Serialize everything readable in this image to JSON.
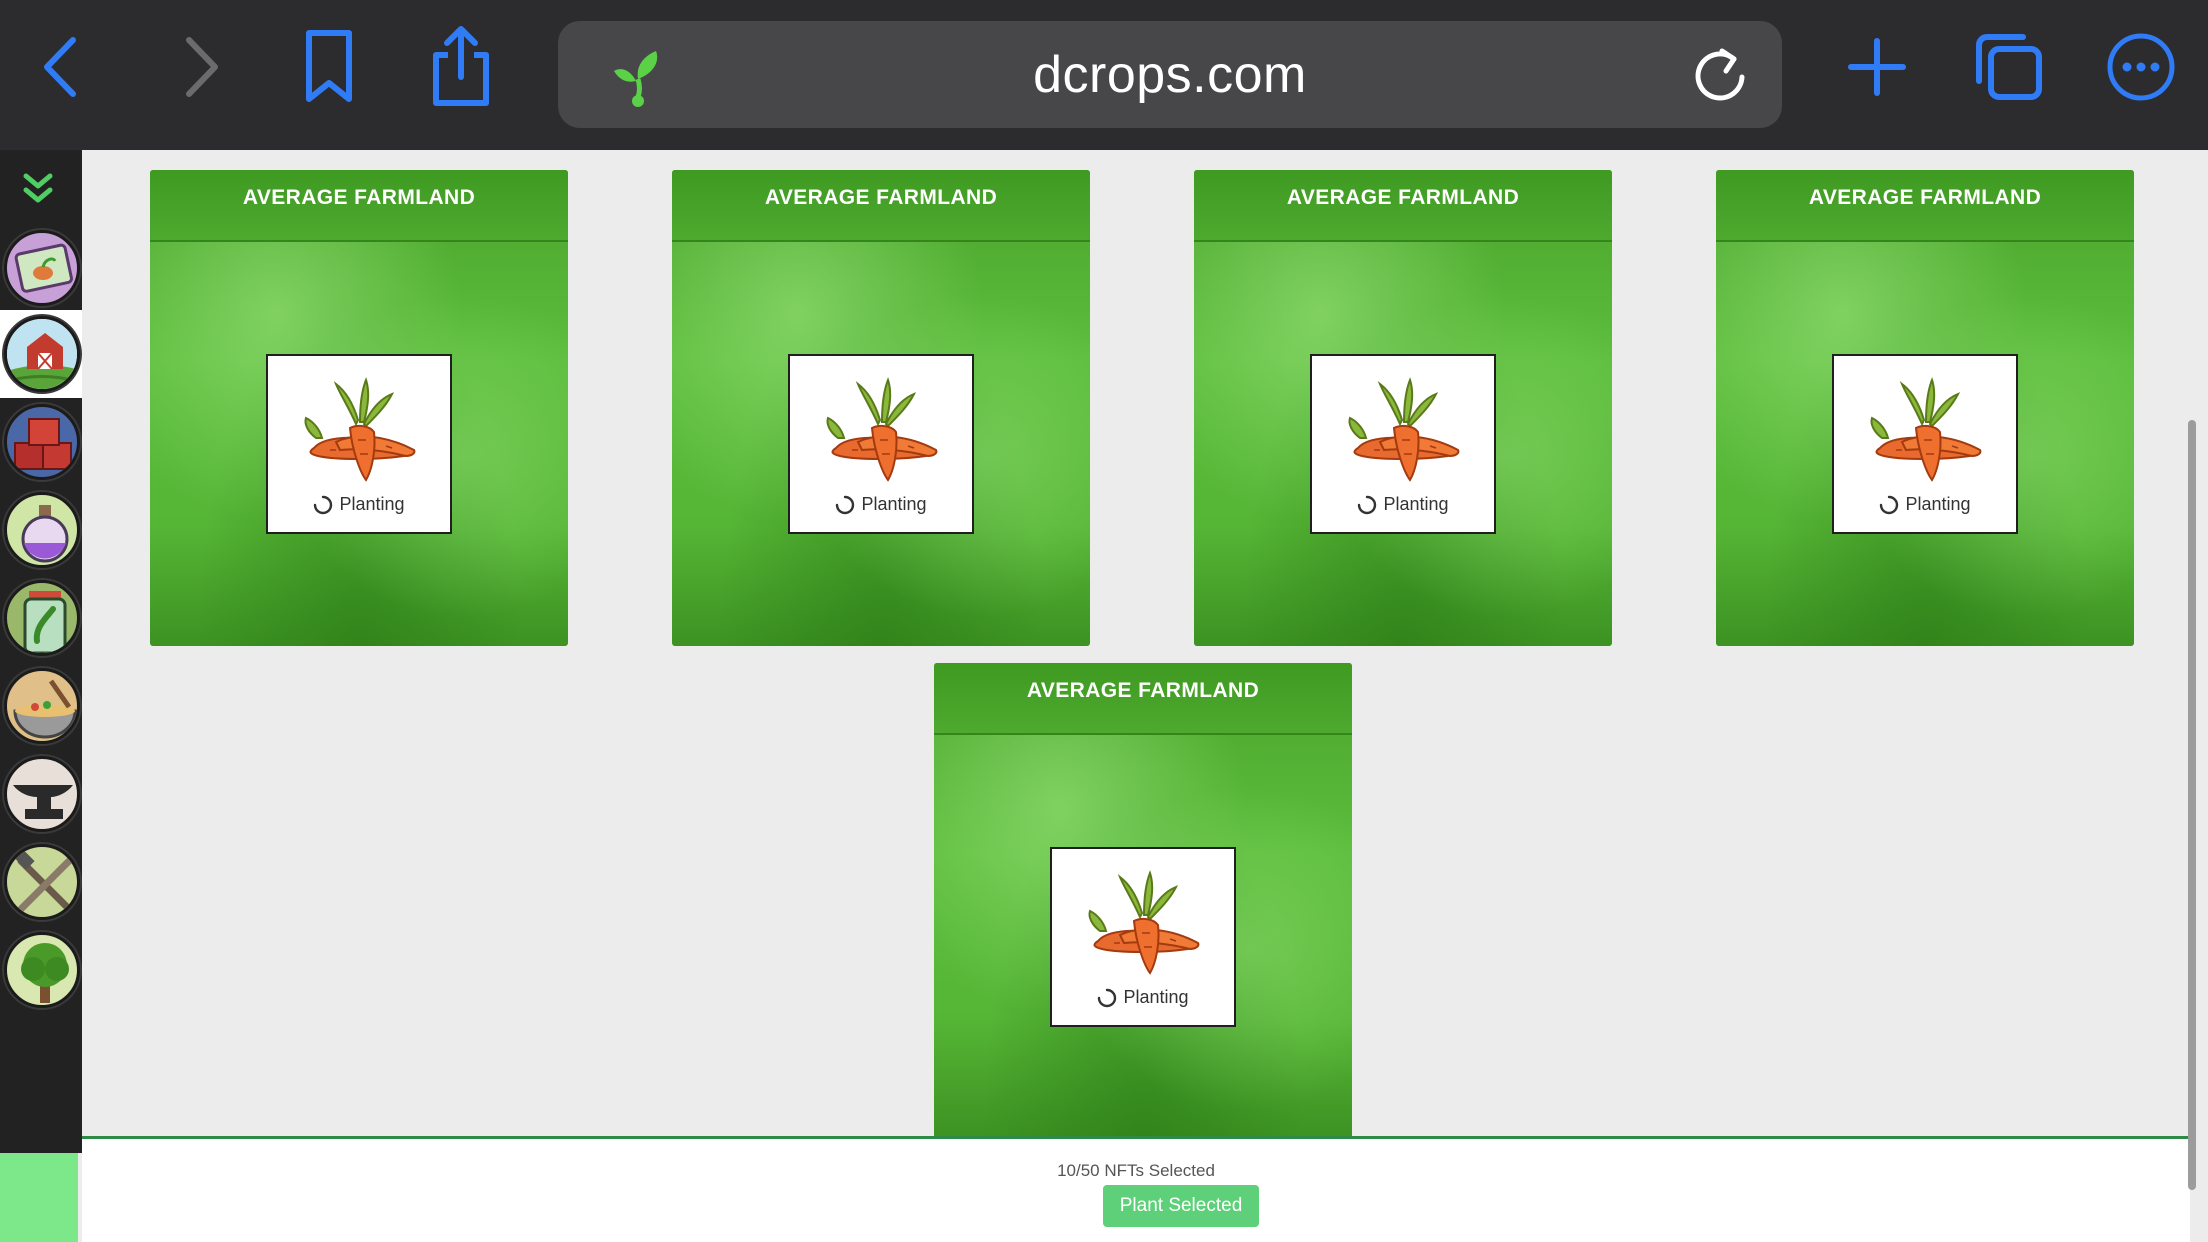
{
  "browser": {
    "url": "dcrops.com",
    "buttons": {
      "back": "back-icon",
      "forward": "forward-icon",
      "bookmarks": "bookmark-icon",
      "share": "share-icon",
      "new_tab": "plus-icon",
      "tabs": "tabs-icon",
      "more": "more-icon",
      "reload": "reload-icon"
    },
    "accent_color": "#2f7cf6"
  },
  "sidebar": {
    "items": [
      {
        "icon": "seed-screen-icon"
      },
      {
        "icon": "farm-barn-icon",
        "active": true
      },
      {
        "icon": "crates-icon"
      },
      {
        "icon": "potion-icon"
      },
      {
        "icon": "jar-icon"
      },
      {
        "icon": "cooking-pot-icon"
      },
      {
        "icon": "anvil-icon"
      },
      {
        "icon": "tools-icon"
      },
      {
        "icon": "tree-icon"
      }
    ]
  },
  "farmlands": [
    {
      "title": "AVERAGE FARMLAND",
      "crop": "carrot",
      "status": "Planting"
    },
    {
      "title": "AVERAGE FARMLAND",
      "crop": "carrot",
      "status": "Planting"
    },
    {
      "title": "AVERAGE FARMLAND",
      "crop": "carrot",
      "status": "Planting"
    },
    {
      "title": "AVERAGE FARMLAND",
      "crop": "carrot",
      "status": "Planting"
    },
    {
      "title": "AVERAGE FARMLAND",
      "crop": "carrot",
      "status": "Planting"
    }
  ],
  "footer": {
    "selected_text": "10/50 NFTs Selected",
    "plant_button": "Plant Selected",
    "button_color": "#5fd07a"
  }
}
